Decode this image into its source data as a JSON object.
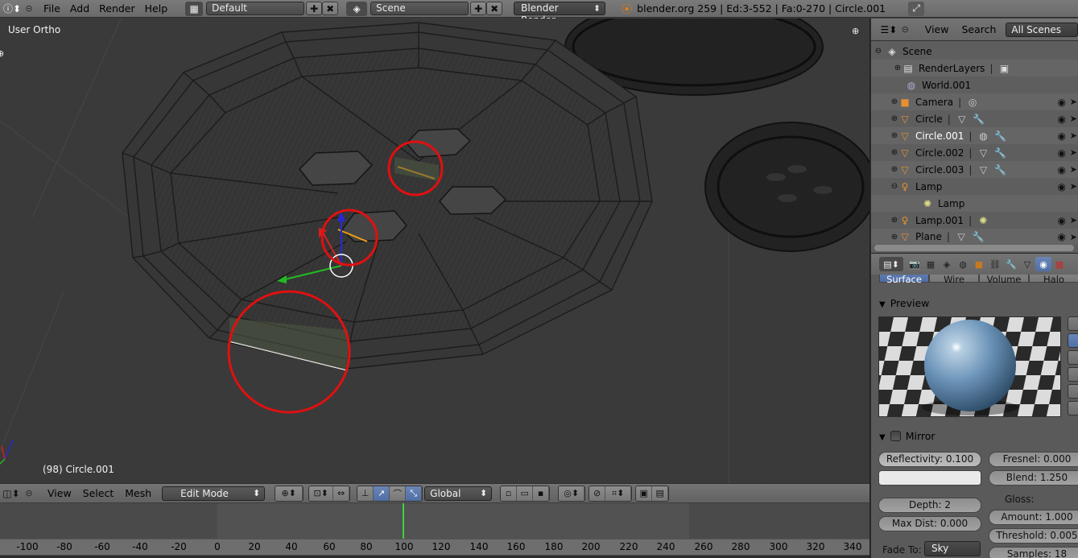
{
  "topbar": {
    "menus": [
      "File",
      "Add",
      "Render",
      "Help"
    ],
    "layout": "Default",
    "scene": "Scene",
    "engine": "Blender Render",
    "stats": "blender.org 259 | Ed:3-552 | Fa:0-270 | Circle.001"
  },
  "viewport": {
    "view_label": "User Ortho",
    "object_label": "(98) Circle.001"
  },
  "view_header": {
    "menus": [
      "View",
      "Select",
      "Mesh"
    ],
    "mode": "Edit Mode",
    "orientation": "Global"
  },
  "timeline": {
    "ticks": [
      "-100",
      "-80",
      "-60",
      "-40",
      "-20",
      "0",
      "20",
      "40",
      "60",
      "80",
      "100",
      "120",
      "140",
      "160",
      "180",
      "200",
      "220",
      "240",
      "260",
      "280",
      "300",
      "320",
      "340"
    ],
    "current_frame": 100
  },
  "outliner": {
    "menus": [
      "View",
      "Search"
    ],
    "filter": "All Scenes",
    "items": [
      {
        "label": "Scene",
        "icon": "scene-icon"
      },
      {
        "label": "RenderLayers",
        "icon": "render-layers-icon"
      },
      {
        "label": "World.001",
        "icon": "world-icon"
      },
      {
        "label": "Camera",
        "icon": "camera-icon"
      },
      {
        "label": "Circle",
        "icon": "mesh-object-icon"
      },
      {
        "label": "Circle.001",
        "icon": "mesh-object-icon",
        "selected": true
      },
      {
        "label": "Circle.002",
        "icon": "mesh-object-icon"
      },
      {
        "label": "Circle.003",
        "icon": "mesh-object-icon"
      },
      {
        "label": "Lamp",
        "icon": "lamp-object-icon"
      },
      {
        "label": "Lamp",
        "icon": "lamp-data-icon"
      },
      {
        "label": "Lamp.001",
        "icon": "lamp-object-icon"
      },
      {
        "label": "Plane",
        "icon": "mesh-object-icon"
      }
    ]
  },
  "properties": {
    "material_tabs": [
      "Surface",
      "Wire",
      "Volume",
      "Halo"
    ],
    "preview_title": "Preview",
    "mirror_title": "Mirror",
    "reflectivity": "Reflectivity: 0.100",
    "fresnel": "Fresnel: 0.000",
    "blend": "Blend: 1.250",
    "depth": "Depth: 2",
    "max_dist": "Max Dist: 0.000",
    "gloss_label": "Gloss:",
    "amount": "Amount: 1.000",
    "threshold": "Threshold: 0.005",
    "fade_to_label": "Fade To:",
    "fade_to": "Sky",
    "samples": "Samples: 18"
  },
  "colors": {
    "accent": "#5a78ad",
    "highlight_circle": "#e01010",
    "timeline_cursor": "#3ed33e"
  }
}
